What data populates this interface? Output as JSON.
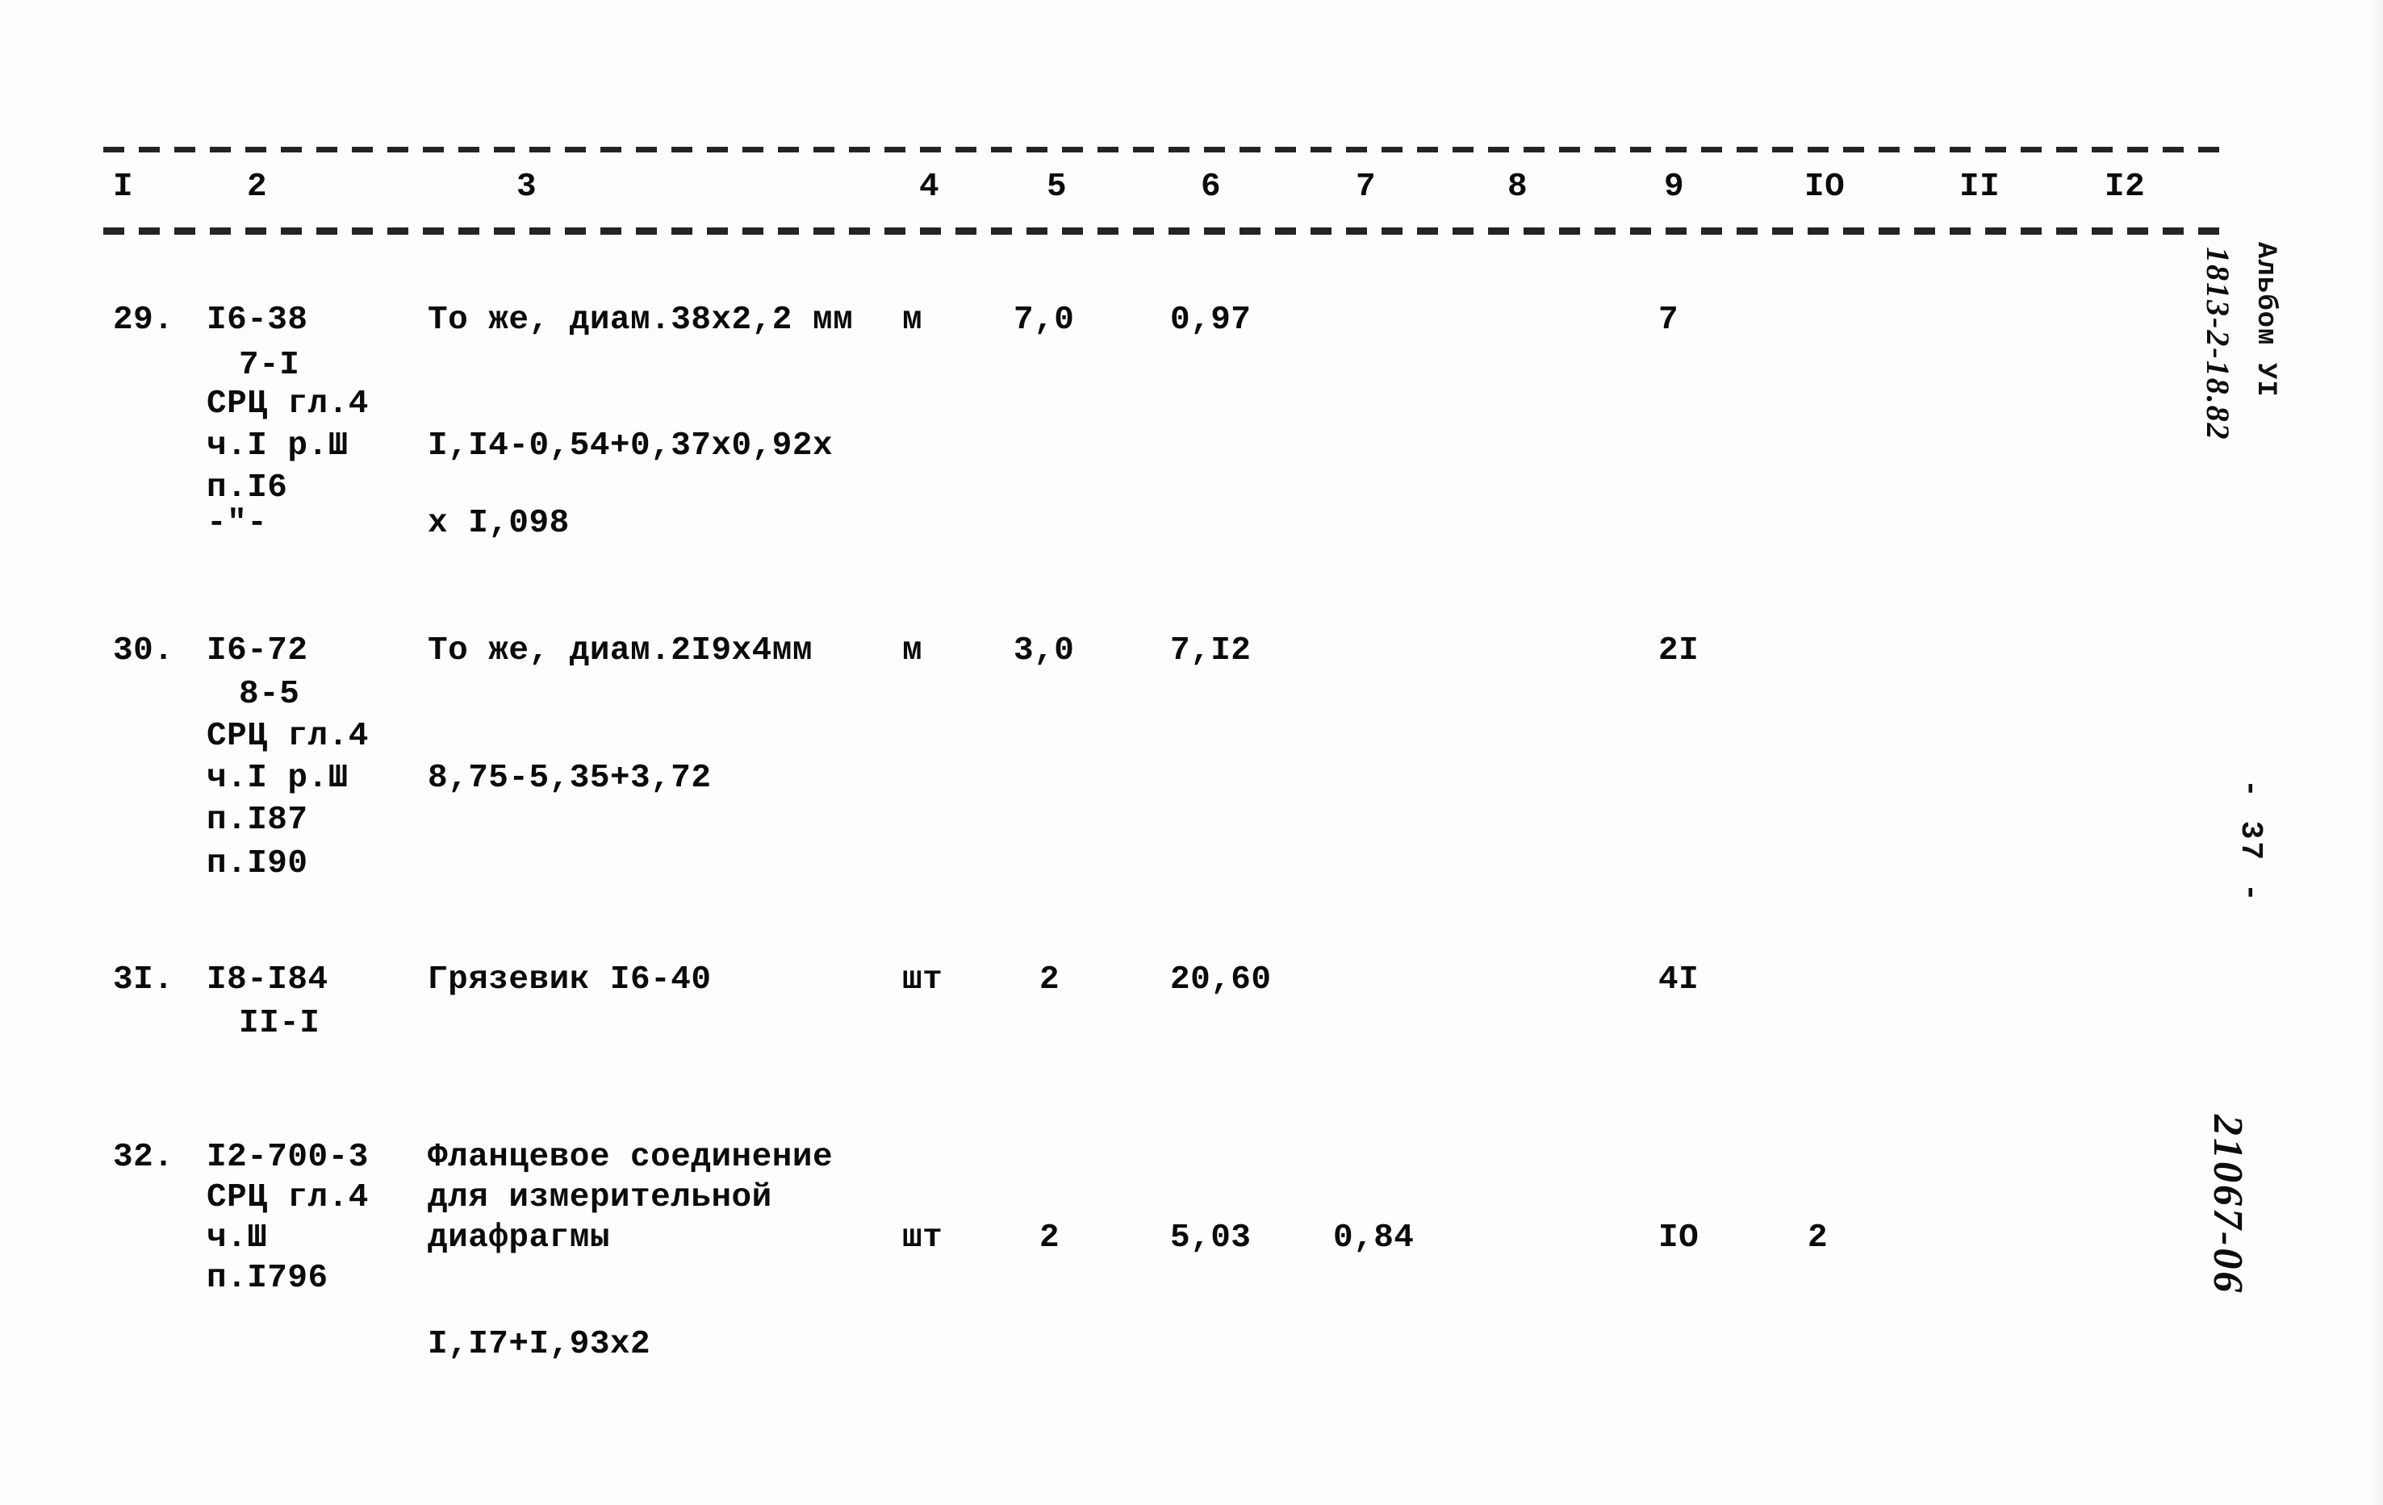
{
  "document": {
    "kind": "scanned-estimate-table",
    "page_number": "- 37 -",
    "album_stamp": "Альбом УI",
    "album_code": "1813-2-18.82",
    "archive_code": "21067-06"
  },
  "table": {
    "column_headers": [
      "I",
      "2",
      "3",
      "4",
      "5",
      "6",
      "7",
      "8",
      "9",
      "IO",
      "II",
      "I2"
    ],
    "rows": [
      {
        "no": "29.",
        "code_lines": [
          "I6-38",
          "7-I",
          "СРЦ гл.4",
          "ч.I р.Ш",
          "п.I6",
          "-\"-"
        ],
        "description_lines": [
          "То же, диам.38х2,2 мм",
          "",
          "",
          "I,I4-0,54+0,37х0,92х",
          "",
          "х I,098"
        ],
        "unit": "м",
        "qty": "7,0",
        "price": "0,97",
        "col7": "",
        "col8": "",
        "col9": "7",
        "col10": "",
        "col11": "",
        "col12": ""
      },
      {
        "no": "30.",
        "code_lines": [
          "I6-72",
          "8-5",
          "СРЦ гл.4",
          "ч.I р.Ш",
          "п.I87",
          "п.I90"
        ],
        "description_lines": [
          "То же, диам.2I9х4мм",
          "",
          "",
          "8,75-5,35+3,72",
          "",
          ""
        ],
        "unit": "м",
        "qty": "3,0",
        "price": "7,I2",
        "col7": "",
        "col8": "",
        "col9": "2I",
        "col10": "",
        "col11": "",
        "col12": ""
      },
      {
        "no": "3I.",
        "code_lines": [
          "I8-I84",
          "II-I"
        ],
        "description_lines": [
          "Грязевик I6-40"
        ],
        "unit": "шт",
        "qty": "2",
        "price": "20,60",
        "col7": "",
        "col8": "",
        "col9": "4I",
        "col10": "",
        "col11": "",
        "col12": ""
      },
      {
        "no": "32.",
        "code_lines": [
          "I2-700-3",
          "СРЦ гл.4",
          "ч.Ш",
          "п.I796"
        ],
        "description_lines": [
          "Фланцевое соединение",
          "для измерительной",
          "диафрагмы",
          "",
          "I,I7+I,93х2"
        ],
        "unit": "шт",
        "qty": "2",
        "price": "5,03",
        "col7": "0,84",
        "col8": "",
        "col9": "IO",
        "col10": "2",
        "col11": "",
        "col12": ""
      }
    ]
  }
}
